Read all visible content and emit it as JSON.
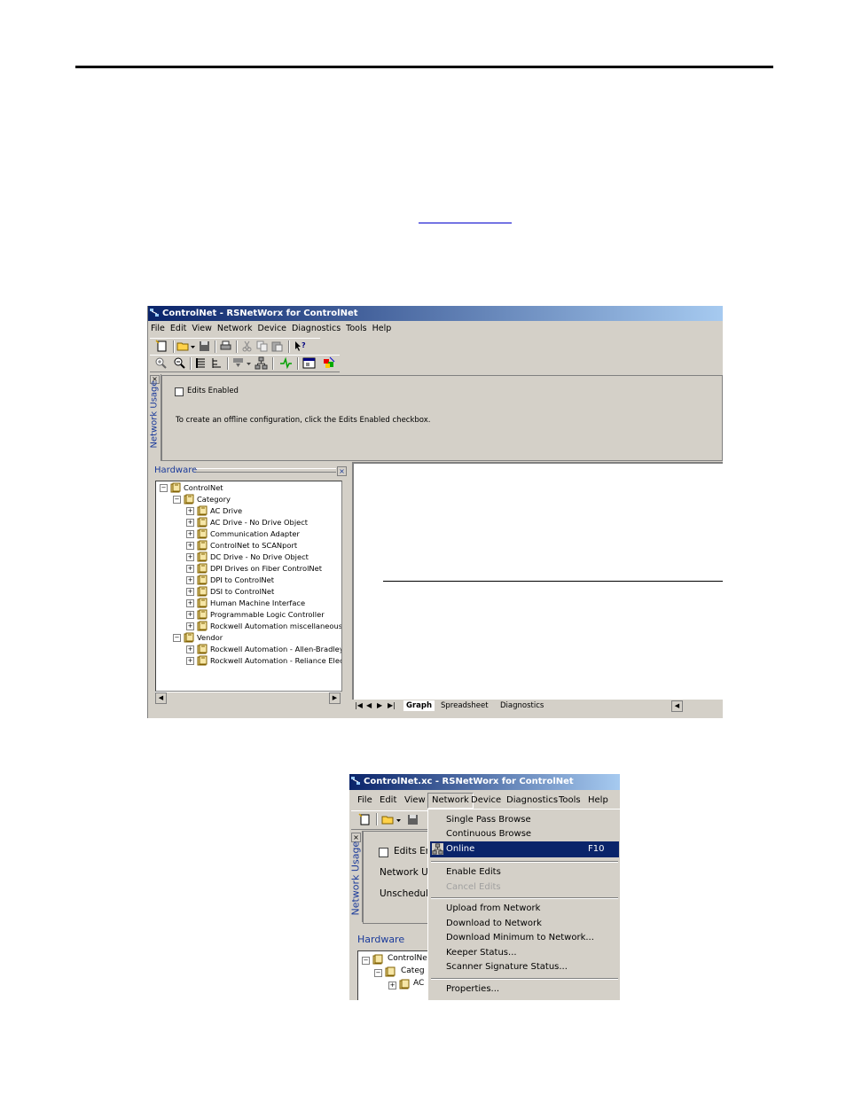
{
  "window1": {
    "title": "ControlNet - RSNetWorx for ControlNet",
    "menu": [
      "File",
      "Edit",
      "View",
      "Network",
      "Device",
      "Diagnostics",
      "Tools",
      "Help"
    ],
    "network_usage": {
      "side_label": "Network Usage",
      "close_glyph": "×",
      "edits_enabled_label": "Edits Enabled",
      "edits_enabled_checked": false,
      "message": "To create an offline configuration, click the Edits Enabled checkbox."
    },
    "hardware": {
      "header": "Hardware",
      "tree": [
        {
          "label": "ControlNet",
          "depth": 0,
          "expander": "−"
        },
        {
          "label": "Category",
          "depth": 1,
          "expander": "−"
        },
        {
          "label": "AC Drive",
          "depth": 2,
          "expander": "+"
        },
        {
          "label": "AC Drive - No Drive Object",
          "depth": 2,
          "expander": "+"
        },
        {
          "label": "Communication Adapter",
          "depth": 2,
          "expander": "+"
        },
        {
          "label": "ControlNet to SCANport",
          "depth": 2,
          "expander": "+"
        },
        {
          "label": "DC Drive - No Drive Object",
          "depth": 2,
          "expander": "+"
        },
        {
          "label": "DPI Drives on Fiber ControlNet",
          "depth": 2,
          "expander": "+"
        },
        {
          "label": "DPI to ControlNet",
          "depth": 2,
          "expander": "+"
        },
        {
          "label": "DSI to ControlNet",
          "depth": 2,
          "expander": "+"
        },
        {
          "label": "Human Machine Interface",
          "depth": 2,
          "expander": "+"
        },
        {
          "label": "Programmable Logic Controller",
          "depth": 2,
          "expander": "+"
        },
        {
          "label": "Rockwell Automation miscellaneous",
          "depth": 2,
          "expander": "+"
        },
        {
          "label": "Vendor",
          "depth": 1,
          "expander": "−"
        },
        {
          "label": "Rockwell Automation - Allen-Bradley",
          "depth": 2,
          "expander": "+"
        },
        {
          "label": "Rockwell Automation - Reliance Electri",
          "depth": 2,
          "expander": "+"
        }
      ]
    },
    "tabs": [
      "Graph",
      "Spreadsheet",
      "Diagnostics"
    ],
    "active_tab": "Graph"
  },
  "window2": {
    "title": "ControlNet.xc - RSNetWorx for ControlNet",
    "menu": [
      "File",
      "Edit",
      "View",
      "Network",
      "Device",
      "Diagnostics",
      "Tools",
      "Help"
    ],
    "active_menu": "Network",
    "partial_labels": {
      "edits": "Edits Ena",
      "network_update": "Network Up",
      "unscheduled": "Unschedule",
      "side_label": "Network Usage",
      "hardware": "Hardware",
      "tree_root": "ControlNe",
      "tree_category": "Categ",
      "tree_item": "AC"
    },
    "network_menu": {
      "group1": [
        "Single Pass Browse",
        "Continuous Browse"
      ],
      "online": {
        "label": "Online",
        "shortcut": "F10"
      },
      "group2": [
        {
          "label": "Enable Edits",
          "disabled": false
        },
        {
          "label": "Cancel Edits",
          "disabled": true
        }
      ],
      "group3": [
        "Upload from Network",
        "Download to Network",
        "Download Minimum to Network...",
        "Keeper Status...",
        "Scanner Signature Status..."
      ],
      "group4": [
        "Properties..."
      ]
    }
  }
}
